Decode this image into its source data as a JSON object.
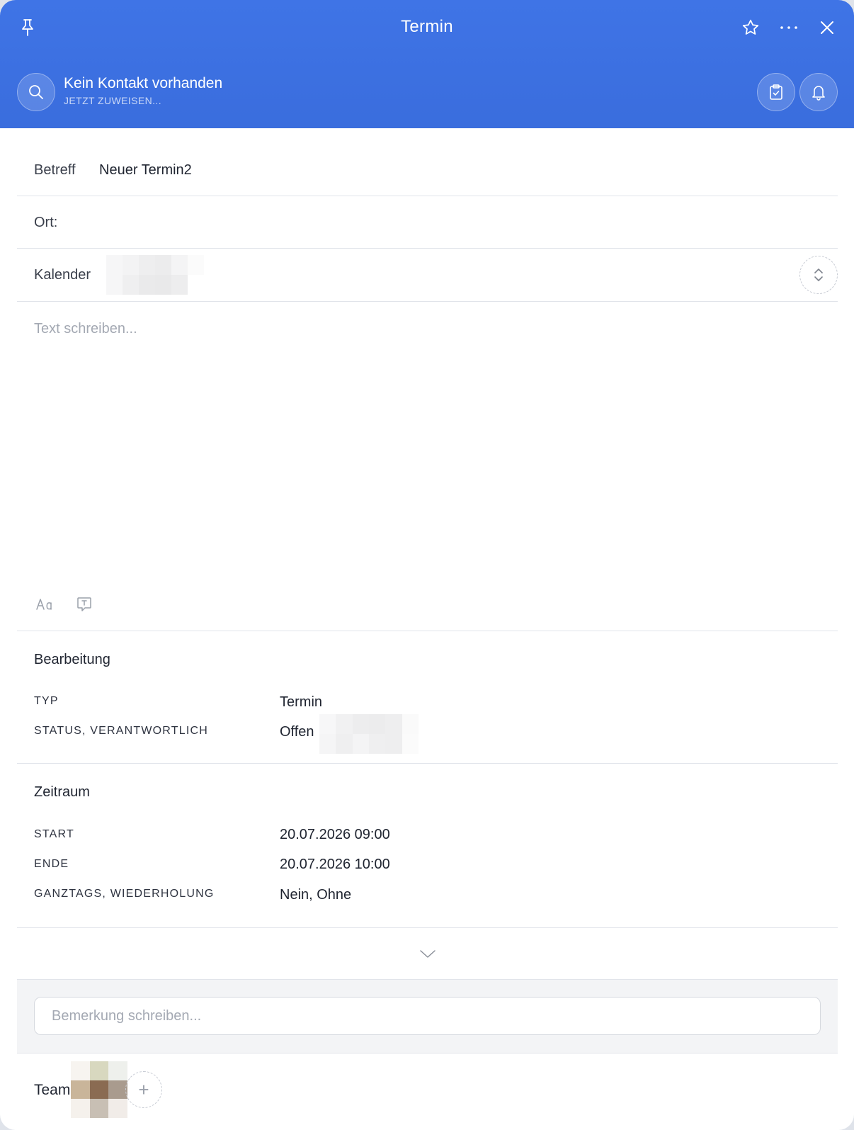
{
  "header": {
    "title": "Termin",
    "contact_name": "Kein Kontakt vorhanden",
    "contact_action": "JETZT ZUWEISEN...",
    "icons": [
      "pin-icon",
      "star-icon",
      "more-icon",
      "close-icon",
      "search-icon",
      "clipboard-check-icon",
      "bell-icon"
    ]
  },
  "form": {
    "subject_label": "Betreff",
    "subject_value": "Neuer Termin2",
    "location_label": "Ort:",
    "location_value": "",
    "calendar_label": "Kalender",
    "text_placeholder": "Text schreiben..."
  },
  "processing": {
    "title": "Bearbeitung",
    "type_label": "TYP",
    "type_value": "Termin",
    "status_label": "STATUS,  VERANTWORTLICH",
    "status_value": "Offen"
  },
  "period": {
    "title": "Zeitraum",
    "start_label": "START",
    "start_value": "20.07.2026 09:00",
    "end_label": "ENDE",
    "end_value": "20.07.2026 10:00",
    "allday_label": "GANZTAGS,  WIEDERHOLUNG",
    "allday_value": "Nein,  Ohne"
  },
  "comment": {
    "placeholder": "Bemerkung schreiben..."
  },
  "team": {
    "label": "Team",
    "add_symbol": "+"
  },
  "colors": {
    "header_blue": "#3f74e6",
    "divider": "#e1e4ea",
    "placeholder": "#a4a9b3"
  }
}
